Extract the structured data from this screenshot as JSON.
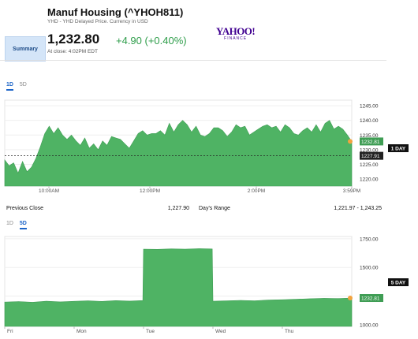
{
  "header": {
    "title": "Manuf Housing (^YHOH811)",
    "subtitle": "YHD - YHD Delayed Price. Currency in USD",
    "summary_label": "Summary",
    "price": "1,232.80",
    "change": "+4.90 (+0.40%)",
    "close_time": "At close: 4:02PM EDT",
    "logo_top": "YAHOO!",
    "logo_bottom": "FINANCE"
  },
  "tabs_top": [
    {
      "label": "1D",
      "active": true
    },
    {
      "label": "5D",
      "active": false
    }
  ],
  "tabs_bottom": [
    {
      "label": "1D",
      "active": false
    },
    {
      "label": "5D",
      "active": true
    }
  ],
  "stats": {
    "prev_close_label": "Previous Close",
    "prev_close_value": "1,227.90",
    "day_range_label": "Day's Range",
    "day_range_value": "1,221.97 - 1,243.25"
  },
  "colors": {
    "fill": "#4fb364",
    "fill_light": "#6cc27f",
    "marker": "#f3a33f",
    "accent": "#1b64c8"
  },
  "chart_data": [
    {
      "type": "area",
      "title": "",
      "range_label": "1 DAY",
      "x_ticks": [
        "10:00AM",
        "12:00PM",
        "2:00PM",
        "3:59PM"
      ],
      "y_ticks": [
        1245.0,
        1240.0,
        1235.0,
        1230.0,
        1225.0,
        1220.0
      ],
      "y_tick_labels": [
        "1245.00",
        "1240.00",
        "1235.00",
        "1230.00",
        "1225.00",
        "1220.00"
      ],
      "ylim": [
        1217.6,
        1246.9
      ],
      "xlim": [
        0,
        390
      ],
      "last_value": 1232.81,
      "last_label": "1232.81",
      "prev_close": 1227.91,
      "prev_close_label": "1227.91",
      "x": [
        0,
        5,
        10,
        15,
        20,
        25,
        30,
        35,
        40,
        45,
        50,
        55,
        60,
        65,
        70,
        75,
        80,
        85,
        90,
        95,
        100,
        105,
        110,
        115,
        120,
        125,
        130,
        135,
        140,
        145,
        150,
        155,
        160,
        165,
        170,
        175,
        180,
        185,
        190,
        195,
        200,
        205,
        210,
        215,
        220,
        225,
        230,
        235,
        240,
        245,
        250,
        255,
        260,
        265,
        270,
        275,
        280,
        285,
        290,
        295,
        300,
        305,
        310,
        315,
        320,
        325,
        330,
        335,
        340,
        345,
        350,
        355,
        360,
        365,
        370,
        375,
        380,
        385,
        390
      ],
      "values": [
        1226.5,
        1224.5,
        1225.5,
        1222.0,
        1226.0,
        1222.5,
        1224.0,
        1227.0,
        1231.0,
        1235.5,
        1238.0,
        1235.5,
        1237.5,
        1235.0,
        1233.5,
        1235.0,
        1233.0,
        1231.5,
        1234.0,
        1230.5,
        1232.0,
        1230.0,
        1233.0,
        1231.5,
        1234.5,
        1234.0,
        1233.5,
        1232.0,
        1230.5,
        1233.0,
        1235.5,
        1236.5,
        1235.0,
        1235.5,
        1235.5,
        1236.5,
        1235.0,
        1239.0,
        1236.0,
        1238.5,
        1240.0,
        1238.5,
        1236.0,
        1238.0,
        1235.0,
        1234.5,
        1235.5,
        1237.5,
        1237.5,
        1236.5,
        1234.5,
        1236.0,
        1238.5,
        1237.5,
        1238.0,
        1235.0,
        1236.0,
        1237.0,
        1238.0,
        1238.5,
        1237.5,
        1238.0,
        1236.0,
        1238.5,
        1237.5,
        1235.5,
        1235.0,
        1236.5,
        1237.5,
        1236.0,
        1238.5,
        1236.0,
        1239.0,
        1240.0,
        1237.0,
        1238.0,
        1237.0,
        1235.0,
        1232.8
      ]
    },
    {
      "type": "area",
      "title": "",
      "range_label": "5 DAY",
      "x_ticks": [
        "Fri",
        "Mon",
        "Tue",
        "Wed",
        "Thu"
      ],
      "x_tick_positions": [
        0,
        1,
        2,
        3,
        4
      ],
      "y_ticks": [
        1750.0,
        1500.0,
        1250.0,
        1000.0
      ],
      "y_tick_labels": [
        "1750.00",
        "1500.00",
        "1250.00",
        "1000.00"
      ],
      "ylim": [
        985,
        1770
      ],
      "xlim": [
        0,
        5
      ],
      "last_value": 1232.81,
      "last_label": "1232.81",
      "x": [
        0,
        0.2,
        0.4,
        0.6,
        0.8,
        1.0,
        1.2,
        1.4,
        1.6,
        1.8,
        1.99,
        2.0,
        2.2,
        2.4,
        2.6,
        2.8,
        2.99,
        3.0,
        3.2,
        3.4,
        3.6,
        3.8,
        4.0,
        4.2,
        4.4,
        4.6,
        4.8,
        5.0
      ],
      "values": [
        1197,
        1202,
        1196,
        1205,
        1199,
        1204,
        1208,
        1203,
        1210,
        1206,
        1211,
        1660,
        1658,
        1662,
        1660,
        1664,
        1661,
        1205,
        1208,
        1212,
        1209,
        1215,
        1218,
        1222,
        1227,
        1230,
        1228,
        1232.8
      ]
    }
  ]
}
